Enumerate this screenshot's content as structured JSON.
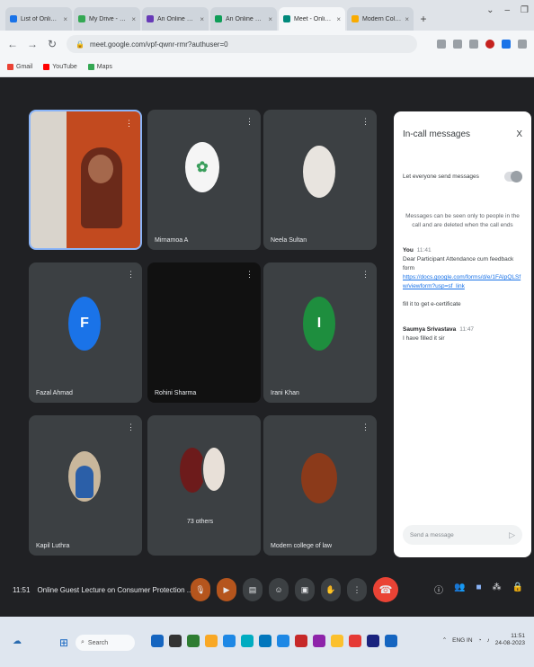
{
  "browser": {
    "tabs": [
      {
        "title": "List of Online Lecture",
        "color": "#1a73e8",
        "active": false
      },
      {
        "title": "My Drive - Google Dr",
        "color": "#34a853",
        "active": false
      },
      {
        "title": "An Online Guest Lect",
        "color": "#673ab7",
        "active": false
      },
      {
        "title": "An Online Guest Lect",
        "color": "#0f9d58",
        "active": false
      },
      {
        "title": "Meet - Online G",
        "color": "#00897b",
        "active": true
      },
      {
        "title": "Modern College of L",
        "color": "#f9ab00",
        "active": false
      }
    ],
    "new_tab": "+",
    "url": "meet.google.com/vpf-qwnr-rmr?authuser=0",
    "bookmarks": [
      {
        "label": "Gmail",
        "color": "#ea4335"
      },
      {
        "label": "YouTube",
        "color": "#ff0000"
      },
      {
        "label": "Maps",
        "color": "#34a853"
      }
    ]
  },
  "participants": [
    {
      "name": "",
      "type": "video",
      "avatar_color": "#8d4a2b"
    },
    {
      "name": "Mirnamoa A",
      "type": "avatar",
      "avatar_color": "#f5f5f5"
    },
    {
      "name": "Neela Sultan",
      "type": "avatar",
      "avatar_color": "#e8e4df"
    },
    {
      "name": "Fazal Ahmad",
      "type": "avatar",
      "avatar_color": "#1a73e8"
    },
    {
      "name": "Rohini Sharma",
      "type": "off",
      "avatar_color": "#111111"
    },
    {
      "name": "Irani Khan",
      "type": "avatar",
      "avatar_color": "#1e8e3e"
    },
    {
      "name": "Kapil Luthra",
      "type": "avatar",
      "avatar_color": "#c9b79c"
    },
    {
      "name": "73 others",
      "type": "group",
      "avatar_color": "#6d1b1b"
    },
    {
      "name": "Modern college of law",
      "type": "avatar",
      "avatar_color": "#8b3a1a"
    }
  ],
  "chat": {
    "title": "In-call messages",
    "close": "X",
    "toggle_label": "Let everyone send messages",
    "notice": "Messages can be seen only to people in the call and are deleted when the call ends",
    "messages": [
      {
        "from": "You",
        "time": "11:41",
        "lines": [
          "Dear Participant Attendance cum feedback form"
        ],
        "link": "https://docs.google.com/forms/d/e/1FAIpQLSfw/viewform?usp=sf_link",
        "extra": "fill it to get e-certificate"
      },
      {
        "from": "Saumya Srivastava",
        "time": "11:47",
        "lines": [
          "I have filled it sir"
        ],
        "link": "",
        "extra": ""
      }
    ],
    "input_placeholder": "Send a message"
  },
  "controls": {
    "time": "11:51",
    "meeting_title": "Online Guest Lecture on Consumer Protection ..."
  },
  "taskbar": {
    "search_label": "Search",
    "app_colors": [
      "#1565c0",
      "#333333",
      "#2e7d32",
      "#f9a825",
      "#1e88e5",
      "#00acc1",
      "#0277bd",
      "#1e88e5",
      "#c62828",
      "#8e24aa",
      "#fbc02d",
      "#e53935",
      "#1a237e",
      "#1565c0"
    ],
    "lang": "ENG IN",
    "time": "11:51",
    "date": "24-08-2023"
  }
}
